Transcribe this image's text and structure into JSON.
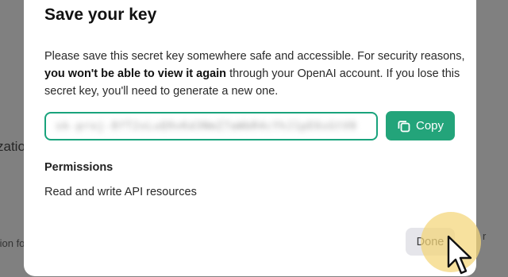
{
  "background": {
    "partial_text_1": "zatio",
    "partial_text_2": "tion fo",
    "partial_text_3": "r"
  },
  "modal": {
    "title": "Save your key",
    "description_part1": "Please save this secret key somewhere safe and accessible. For security reasons, ",
    "description_bold": "you won't be able to view it again",
    "description_part2": " through your OpenAI account. If you lose this secret key, you'll need to generate a new one.",
    "key_value": "sk-proj-8fT2xLuQ9vKd3NmZ7aWbR4cYhJ1pE6sGtV0",
    "copy_label": "Copy",
    "permissions_heading": "Permissions",
    "permissions_value": "Read and write API resources",
    "done_label": "Done"
  },
  "colors": {
    "accent": "#23a47a",
    "field_border": "#19a37c",
    "done_bg": "#e5e5ea",
    "halo": "#f4d678"
  },
  "icons": {
    "copy": "copy-icon",
    "cursor": "mouse-pointer-icon"
  }
}
